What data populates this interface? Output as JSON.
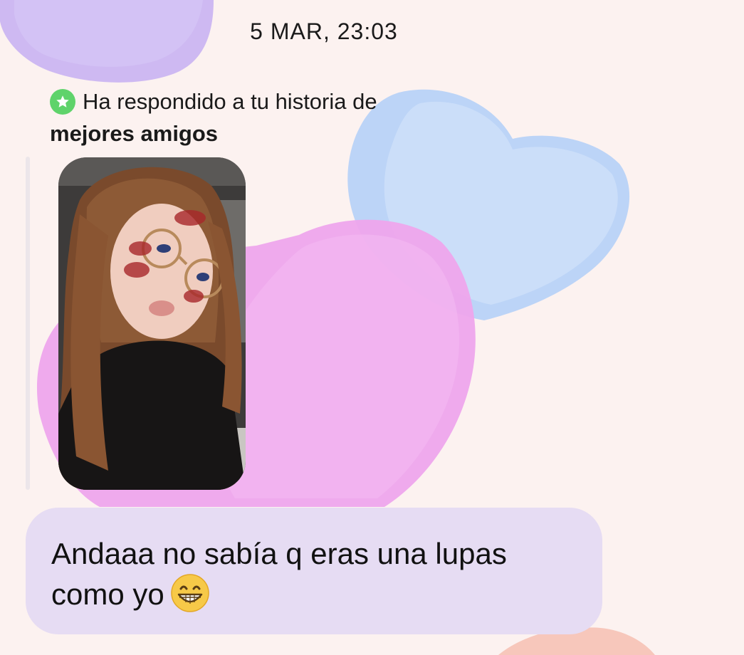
{
  "thread": {
    "timestamp": "5 MAR, 23:03"
  },
  "story_reply": {
    "prefix": "Ha respondido a tu historia de",
    "audience": "mejores amigos",
    "badge_icon": "star-icon",
    "badge_color": "#5fd36b"
  },
  "message": {
    "text_line1": "Andaaa no sabía q eras una lupas",
    "text_line2": "como yo",
    "emoji_icon": "grinning-face-icon",
    "bubble_color": "#e6dcf3"
  },
  "theme": {
    "background": "#fcf2f0",
    "heart_colors": [
      "#c9b5f3",
      "#b9d3f7",
      "#efa6ec",
      "#f6c2b5"
    ]
  }
}
